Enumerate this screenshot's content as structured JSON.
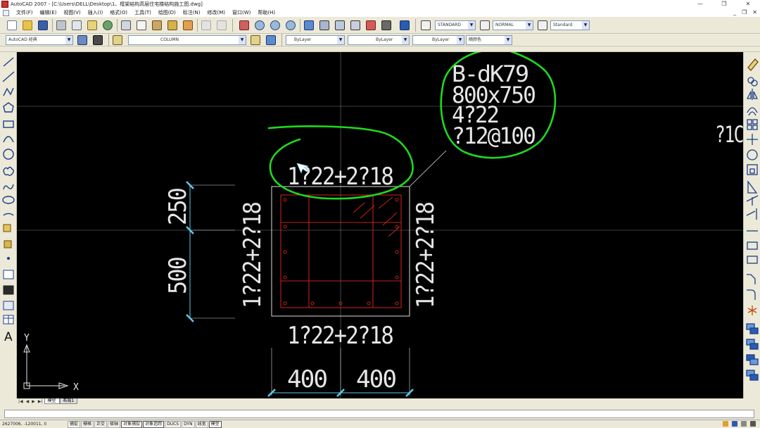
{
  "window": {
    "title": "AutoCAD 2007 - [C:\\Users\\DELL\\Desktop\\1、框架结构高层住宅楼结构施工图.dwg]",
    "controls": [
      "—",
      "❐",
      "✕"
    ]
  },
  "menubar": {
    "items": [
      "文件(F)",
      "编辑(E)",
      "视图(V)",
      "插入(I)",
      "格式(O)",
      "工具(T)",
      "绘图(D)",
      "标注(N)",
      "修改(M)",
      "窗口(W)",
      "帮助(H)"
    ],
    "doc_controls": [
      "_",
      "❐",
      "✕"
    ]
  },
  "toolbar1": {
    "text_style": "STANDARD",
    "dim_style": "NORMAL",
    "table_style": "Standard"
  },
  "toolbar2": {
    "workspace": "AutoCAD 经典",
    "layer": "COLUMN",
    "color": "ByLayer",
    "linetype": "ByLayer",
    "lineweight": "ByLayer",
    "plot_style": "随颜色"
  },
  "drawing": {
    "column_mark": "B-dK79",
    "section_size": "800x750",
    "corner_bars": "4?22",
    "stirrups": "?12@100",
    "top_rebar": "1?22+2?18",
    "bottom_rebar": "1?22+2?18",
    "left_rebar": "1?22+2?18",
    "right_rebar": "1?22+2?18",
    "dim_upper": "250",
    "dim_lower": "500",
    "dim_left_width": "400",
    "dim_right_width": "400",
    "edge_label": "?1C",
    "ucs_x": "X",
    "ucs_y": "Y"
  },
  "layout_tabs": {
    "nav": [
      "|◀",
      "◀",
      "▶",
      "▶|"
    ],
    "tabs": [
      "模型",
      "布局1"
    ]
  },
  "statusbar": {
    "coords": "2627006, -120011, 0",
    "buttons": [
      "捕捉",
      "栅格",
      "正交",
      "极轴",
      "对象捕捉",
      "对象追踪",
      "DUCS",
      "DYN",
      "线宽",
      "模型"
    ]
  },
  "colors": {
    "canvas_bg": "#000000",
    "crosshair": "#b9c6cf",
    "dimension": "#5ec8e8",
    "rebar": "#c0201c",
    "outline": "#ffffff",
    "annotation_circle": "#1fd91f"
  }
}
